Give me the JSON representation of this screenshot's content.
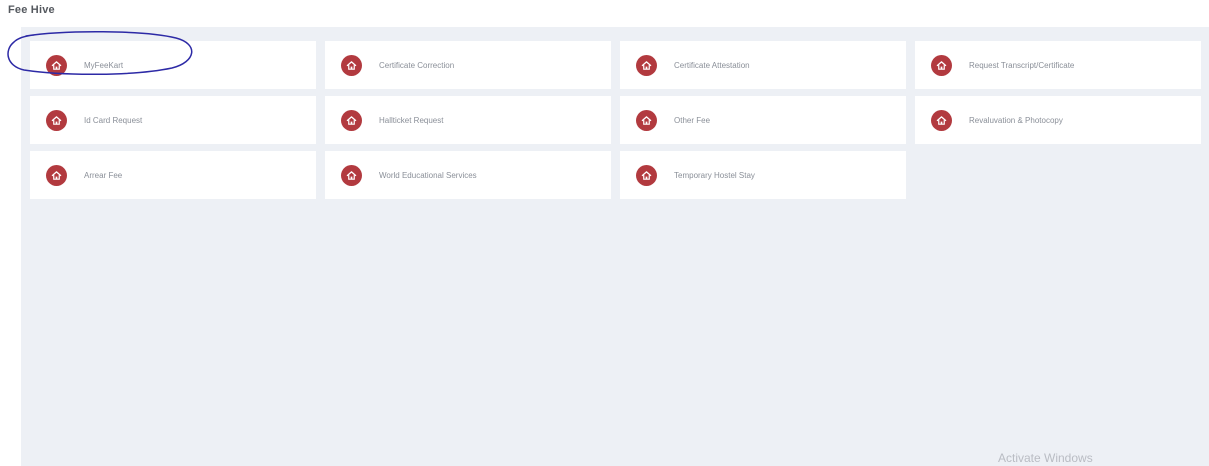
{
  "app": {
    "title": "Fee Hive"
  },
  "tiles": [
    {
      "label": "MyFeeKart",
      "icon": "home-icon"
    },
    {
      "label": "Certificate Correction",
      "icon": "home-icon"
    },
    {
      "label": "Certificate Attestation",
      "icon": "home-icon"
    },
    {
      "label": "Request Transcript/Certificate",
      "icon": "home-icon"
    },
    {
      "label": "Id Card Request",
      "icon": "home-icon"
    },
    {
      "label": "Hallticket Request",
      "icon": "home-icon"
    },
    {
      "label": "Other Fee",
      "icon": "home-icon"
    },
    {
      "label": "Revaluvation & Photocopy",
      "icon": "home-icon"
    },
    {
      "label": "Arrear Fee",
      "icon": "home-icon"
    },
    {
      "label": "World Educational Services",
      "icon": "home-icon"
    },
    {
      "label": "Temporary Hostel Stay",
      "icon": "home-icon"
    }
  ],
  "watermark": {
    "text": "Activate Windows"
  },
  "colors": {
    "icon_bg": "#b23a3f",
    "content_bg": "#edf0f5",
    "annotation_ink": "#2d2aa6"
  }
}
